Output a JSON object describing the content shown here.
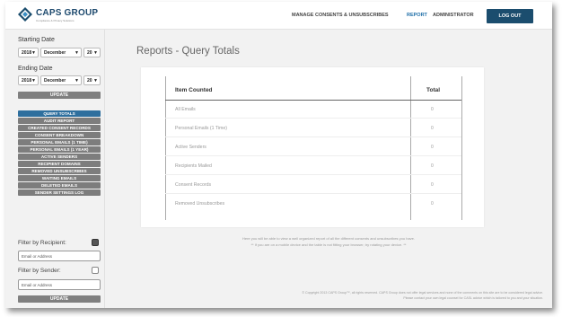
{
  "brand": {
    "name": "CAPS GROUP",
    "tagline": "Compliance & Privacy Solutions",
    "colors": {
      "primary": "#1b4d6e",
      "accent": "#1f6fa8",
      "button_gray": "#7d7d7d"
    }
  },
  "nav": {
    "items": [
      {
        "label": "MANAGE CONSENTS & UNSUBSCRIBES",
        "active": false
      },
      {
        "label": "REPORT",
        "active": true
      },
      {
        "label": "ADMINISTRATOR",
        "active": false
      }
    ],
    "logout_label": "LOG OUT"
  },
  "sidebar": {
    "starting_date": {
      "label": "Starting Date",
      "year": "2018",
      "month": "December",
      "day": "20"
    },
    "ending_date": {
      "label": "Ending Date",
      "year": "2018",
      "month": "December",
      "day": "20"
    },
    "update_label": "UPDATE",
    "menu": [
      {
        "label": "QUERY TOTALS",
        "active": true
      },
      {
        "label": "AUDIT REPORT",
        "active": false
      },
      {
        "label": "CREATED CONSENT RECORDS",
        "active": false
      },
      {
        "label": "CONSENT BREAKDOWN",
        "active": false
      },
      {
        "label": "PERSONAL EMAILS (1 TIME)",
        "active": false
      },
      {
        "label": "PERSONAL EMAILS (1 YEAR)",
        "active": false
      },
      {
        "label": "ACTIVE SENDERS",
        "active": false
      },
      {
        "label": "RECIPIENT DOMAINS",
        "active": false
      },
      {
        "label": "REMOVED UNSUBSCRIBES",
        "active": false
      },
      {
        "label": "WAITING EMAILS",
        "active": false
      },
      {
        "label": "DELETED EMAILS",
        "active": false
      },
      {
        "label": "SENDER SETTINGS LOG",
        "active": false
      }
    ],
    "filter_recipient": {
      "label": "Filter by Recipient:",
      "checked": true,
      "placeholder": "Email or Address"
    },
    "filter_sender": {
      "label": "Filter by Sender:",
      "checked": false,
      "placeholder": "Email or Address"
    },
    "update_label_2": "UPDATE"
  },
  "main": {
    "title": "Reports - Query Totals",
    "table": {
      "headers": [
        "Item Counted",
        "Total"
      ],
      "rows": [
        {
          "item": "All Emails",
          "total": "0"
        },
        {
          "item": "Personal Emails (1 Time)",
          "total": "0"
        },
        {
          "item": "Active Senders",
          "total": "0"
        },
        {
          "item": "Recipients Mailed",
          "total": "0"
        },
        {
          "item": "Consent Records",
          "total": "0"
        },
        {
          "item": "Removed Unsubscribes",
          "total": "0"
        }
      ]
    },
    "info_line_1": "Here you will be able to view a well organized report of all the different consents and unsubscribes you have.",
    "info_line_2": "** If you are on a mobile device and the table is not fitting your browser, try rotating your device. **",
    "copyright_line_1": "© Copyright 2013 CAPS Group™, all rights reserved. CAPS Group does not offer legal services and none of the comments on this site are to be considered legal advice.",
    "copyright_line_2": "Please contact your own legal counsel for CASL advice which is tailored to you and your situation."
  }
}
